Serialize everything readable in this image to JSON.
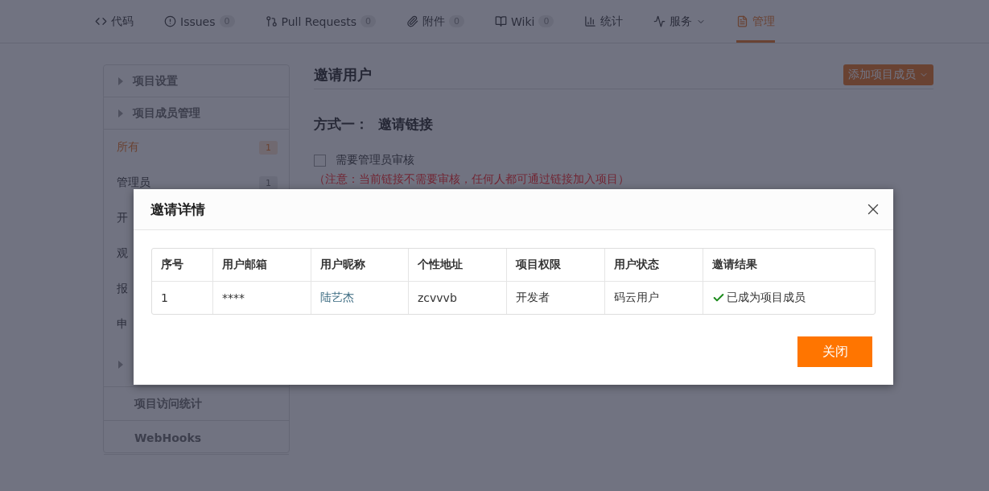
{
  "nav": {
    "tabs": [
      {
        "label": "代码",
        "selected": false
      },
      {
        "label": "Issues",
        "count": "0",
        "selected": false
      },
      {
        "label": "Pull Requests",
        "count": "0",
        "selected": false
      },
      {
        "label": "附件",
        "count": "0",
        "selected": false
      },
      {
        "label": "Wiki",
        "count": "0",
        "selected": false
      },
      {
        "label": "统计",
        "selected": false
      },
      {
        "label": "服务",
        "dropdown": true,
        "selected": false
      },
      {
        "label": "管理",
        "selected": true
      }
    ]
  },
  "sidebar": {
    "items": [
      {
        "kind": "group",
        "label": "项目设置"
      },
      {
        "kind": "group",
        "label": "项目成员管理"
      },
      {
        "kind": "sub",
        "label": "所有",
        "count": "1",
        "selected": true
      },
      {
        "kind": "sub",
        "label": "管理员",
        "count": "1",
        "selected": false
      },
      {
        "kind": "sub",
        "label": "开",
        "selected": false
      },
      {
        "kind": "sub",
        "label": "观",
        "selected": false
      },
      {
        "kind": "sub",
        "label": "报",
        "selected": false
      },
      {
        "kind": "sub",
        "label": "申",
        "selected": false
      },
      {
        "kind": "group"
      },
      {
        "kind": "plain",
        "label": "项目访问统计"
      },
      {
        "kind": "plain",
        "label": "WebHooks"
      }
    ]
  },
  "main": {
    "title": "邀请用户",
    "add_button": "添加项目成员",
    "method_title": "方式一：  邀请链接",
    "review_checkbox": {
      "label": "需要管理员审核",
      "checked": false
    },
    "note": "（注意：当前链接不需要审核，任何人都可通过链接加入项目）"
  },
  "dialog": {
    "title": "邀请详情",
    "columns": [
      "序号",
      "用户邮箱",
      "用户昵称",
      "个性地址",
      "项目权限",
      "用户状态",
      "邀请结果"
    ],
    "rows": [
      {
        "index": "1",
        "email": "****",
        "nickname": "陆艺杰",
        "path": "zcvvvb",
        "role": "开发者",
        "status": "码云用户",
        "result": "已成为项目成员",
        "success": true
      }
    ],
    "close_button": "关闭"
  }
}
